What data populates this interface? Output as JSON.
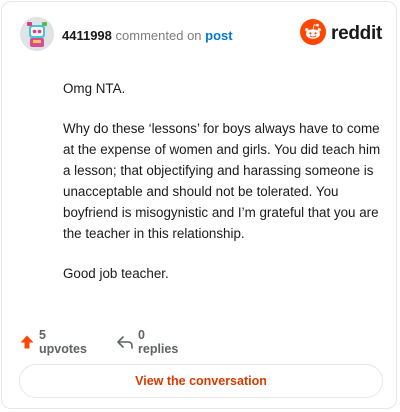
{
  "comment": {
    "username": "4411998",
    "action_text": "commented on",
    "post_link": "post",
    "paragraphs": [
      "Omg NTA.",
      "Why do these ‘lessons’ for boys always have to come at the expense of women and girls. You did teach him a lesson; that objectifying and harassing someone is unacceptable and should not be tolerated. You boyfriend is misogynistic and I’m grateful that you are the teacher in this relationship.",
      "Good job teacher."
    ],
    "upvotes": "5 upvotes",
    "replies": "0 replies",
    "view_button": "View the conversation"
  },
  "brand": {
    "logo_text": "reddit",
    "accent": "#ff4500",
    "link_color": "#0079d3",
    "button_text_color": "#d93a00"
  },
  "icons": {
    "avatar": "avatar-icon",
    "logo": "reddit-alien-icon",
    "upvote": "upvote-arrow-icon",
    "reply": "reply-arrow-icon"
  }
}
